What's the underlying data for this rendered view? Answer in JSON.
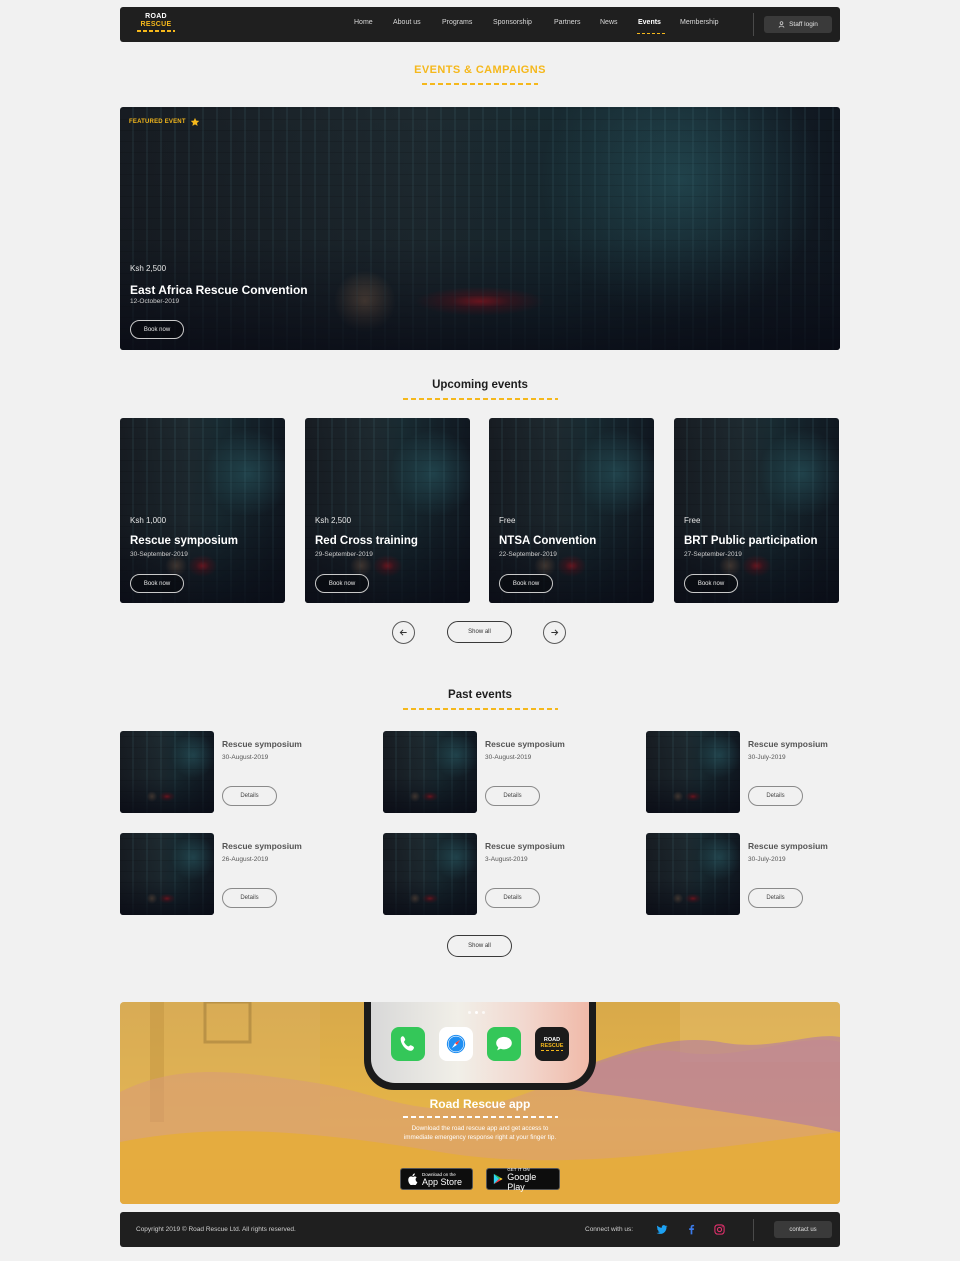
{
  "brand": {
    "line1": "ROAD",
    "line2": "RESCUE"
  },
  "nav": {
    "links": [
      {
        "label": "Home",
        "active": false
      },
      {
        "label": "About us",
        "active": false
      },
      {
        "label": "Programs",
        "active": false
      },
      {
        "label": "Sponsorship",
        "active": false
      },
      {
        "label": "Partners",
        "active": false
      },
      {
        "label": "News",
        "active": false
      },
      {
        "label": "Events",
        "active": true
      },
      {
        "label": "Membership",
        "active": false
      }
    ],
    "staff_login": "Staff login"
  },
  "page_title": "EVENTS & CAMPAIGNS",
  "featured": {
    "label": "FEATURED EVENT",
    "price": "Ksh 2,500",
    "title": "East Africa Rescue Convention",
    "date": "12-October-2019",
    "button": "Book now"
  },
  "upcoming": {
    "title": "Upcoming events",
    "cards": [
      {
        "price": "Ksh 1,000",
        "title": "Rescue symposium",
        "date": "30-September-2019",
        "button": "Book now"
      },
      {
        "price": "Ksh 2,500",
        "title": "Red Cross training",
        "date": "29-September-2019",
        "button": "Book now"
      },
      {
        "price": "Free",
        "title": "NTSA Convention",
        "date": "22-September-2019",
        "button": "Book now"
      },
      {
        "price": "Free",
        "title": "BRT Public participation",
        "date": "27-September-2019",
        "button": "Book now"
      }
    ],
    "show_all": "Show all"
  },
  "past": {
    "title": "Past events",
    "items": [
      {
        "title": "Rescue symposium",
        "date": "30-August-2019",
        "button": "Details"
      },
      {
        "title": "Rescue symposium",
        "date": "30-August-2019",
        "button": "Details"
      },
      {
        "title": "Rescue symposium",
        "date": "30-July-2019",
        "button": "Details"
      },
      {
        "title": "Rescue symposium",
        "date": "26-August-2019",
        "button": "Details"
      },
      {
        "title": "Rescue symposium",
        "date": "3-August-2019",
        "button": "Details"
      },
      {
        "title": "Rescue symposium",
        "date": "30-July-2019",
        "button": "Details"
      }
    ],
    "show_all": "Show all"
  },
  "app_banner": {
    "title": "Road Rescue app",
    "text": "Download the road rescue app and get access to immediate emergency response right at your finger tip.",
    "app_store_small": "Download on the",
    "app_store_big": "App Store",
    "google_small": "GET IT ON",
    "google_big": "Google Play",
    "app_icon_label_1": "ROAD",
    "app_icon_label_2": "RESCUE"
  },
  "footer": {
    "copyright": "Copyright 2019 © Road Rescue Ltd. All rights reserved.",
    "connect": "Connect with us:",
    "contact": "contact us"
  },
  "colors": {
    "accent": "#f5b81c",
    "dark": "#1f1f1f",
    "background": "#f1f1f1",
    "twitter": "#1da1f2",
    "facebook": "#3b7bea",
    "instagram": "#e1306c"
  },
  "icons": {
    "staff": "user-icon",
    "featured": "star-icon",
    "prev": "arrow-left-icon",
    "next": "arrow-right-icon",
    "social": [
      "twitter-icon",
      "facebook-icon",
      "instagram-icon"
    ]
  }
}
